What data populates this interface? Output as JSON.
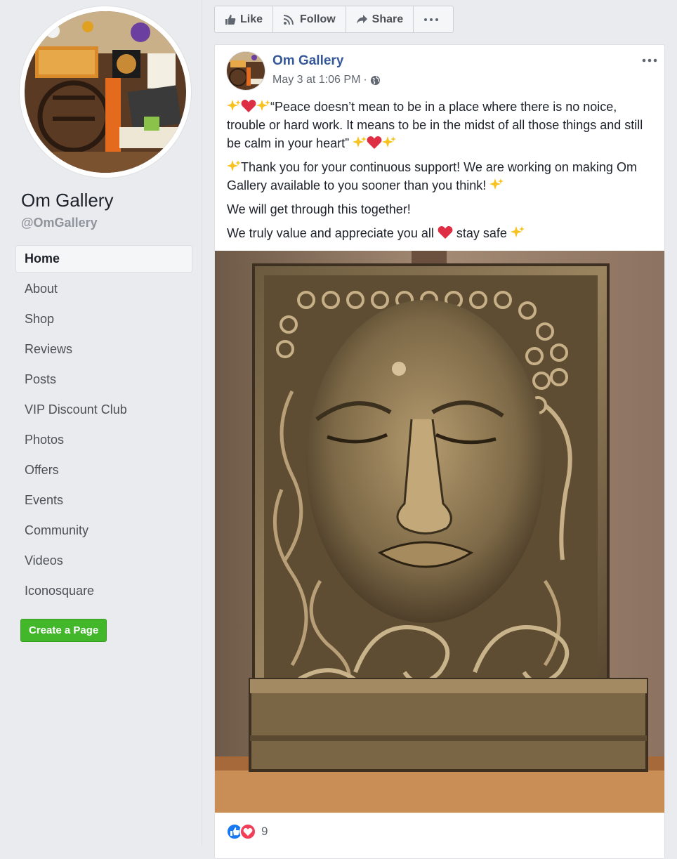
{
  "sidebar": {
    "page_name": "Om Gallery",
    "page_handle": "@OmGallery",
    "nav": [
      {
        "label": "Home",
        "active": true
      },
      {
        "label": "About"
      },
      {
        "label": "Shop"
      },
      {
        "label": "Reviews"
      },
      {
        "label": "Posts"
      },
      {
        "label": "VIP Discount Club"
      },
      {
        "label": "Photos"
      },
      {
        "label": "Offers"
      },
      {
        "label": "Events"
      },
      {
        "label": "Community"
      },
      {
        "label": "Videos"
      },
      {
        "label": "Iconosquare"
      }
    ],
    "create_page_label": "Create a Page"
  },
  "action_bar": {
    "like_label": "Like",
    "follow_label": "Follow",
    "share_label": "Share",
    "more_icon": "more-horizontal-icon"
  },
  "post": {
    "author": "Om Gallery",
    "timestamp": "May 3 at 1:06 PM",
    "separator": "·",
    "privacy_icon": "globe-icon",
    "paragraphs": {
      "p1_quote": "“Peace doesn’t mean to be in a place where there is no noice, trouble or hard work. It means to be in the midst of all those things and still be calm in your heart”",
      "p2": "Thank you for your continuous support! We are working on making Om Gallery available to you sooner than you think!",
      "p3": "We will get through this together!",
      "p4_a": "We truly value and appreciate you all",
      "p4_b": "stay safe"
    },
    "reactions": {
      "icons": [
        "like-reaction-icon",
        "love-reaction-icon"
      ],
      "count": "9"
    }
  },
  "colors": {
    "link_blue": "#365899",
    "create_green": "#42b72a",
    "like_blue": "#1877f2",
    "love_red": "#f33e58"
  }
}
